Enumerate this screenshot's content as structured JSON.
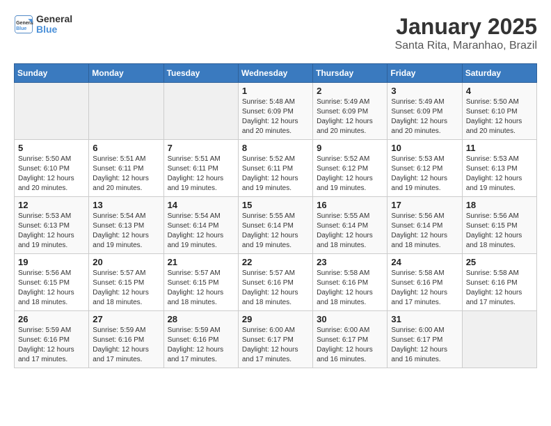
{
  "logo": {
    "line1": "General",
    "line2": "Blue"
  },
  "title": "January 2025",
  "subtitle": "Santa Rita, Maranhao, Brazil",
  "days_of_week": [
    "Sunday",
    "Monday",
    "Tuesday",
    "Wednesday",
    "Thursday",
    "Friday",
    "Saturday"
  ],
  "weeks": [
    [
      {
        "day": "",
        "info": ""
      },
      {
        "day": "",
        "info": ""
      },
      {
        "day": "",
        "info": ""
      },
      {
        "day": "1",
        "info": "Sunrise: 5:48 AM\nSunset: 6:09 PM\nDaylight: 12 hours and 20 minutes."
      },
      {
        "day": "2",
        "info": "Sunrise: 5:49 AM\nSunset: 6:09 PM\nDaylight: 12 hours and 20 minutes."
      },
      {
        "day": "3",
        "info": "Sunrise: 5:49 AM\nSunset: 6:09 PM\nDaylight: 12 hours and 20 minutes."
      },
      {
        "day": "4",
        "info": "Sunrise: 5:50 AM\nSunset: 6:10 PM\nDaylight: 12 hours and 20 minutes."
      }
    ],
    [
      {
        "day": "5",
        "info": "Sunrise: 5:50 AM\nSunset: 6:10 PM\nDaylight: 12 hours and 20 minutes."
      },
      {
        "day": "6",
        "info": "Sunrise: 5:51 AM\nSunset: 6:11 PM\nDaylight: 12 hours and 20 minutes."
      },
      {
        "day": "7",
        "info": "Sunrise: 5:51 AM\nSunset: 6:11 PM\nDaylight: 12 hours and 19 minutes."
      },
      {
        "day": "8",
        "info": "Sunrise: 5:52 AM\nSunset: 6:11 PM\nDaylight: 12 hours and 19 minutes."
      },
      {
        "day": "9",
        "info": "Sunrise: 5:52 AM\nSunset: 6:12 PM\nDaylight: 12 hours and 19 minutes."
      },
      {
        "day": "10",
        "info": "Sunrise: 5:53 AM\nSunset: 6:12 PM\nDaylight: 12 hours and 19 minutes."
      },
      {
        "day": "11",
        "info": "Sunrise: 5:53 AM\nSunset: 6:13 PM\nDaylight: 12 hours and 19 minutes."
      }
    ],
    [
      {
        "day": "12",
        "info": "Sunrise: 5:53 AM\nSunset: 6:13 PM\nDaylight: 12 hours and 19 minutes."
      },
      {
        "day": "13",
        "info": "Sunrise: 5:54 AM\nSunset: 6:13 PM\nDaylight: 12 hours and 19 minutes."
      },
      {
        "day": "14",
        "info": "Sunrise: 5:54 AM\nSunset: 6:14 PM\nDaylight: 12 hours and 19 minutes."
      },
      {
        "day": "15",
        "info": "Sunrise: 5:55 AM\nSunset: 6:14 PM\nDaylight: 12 hours and 19 minutes."
      },
      {
        "day": "16",
        "info": "Sunrise: 5:55 AM\nSunset: 6:14 PM\nDaylight: 12 hours and 18 minutes."
      },
      {
        "day": "17",
        "info": "Sunrise: 5:56 AM\nSunset: 6:14 PM\nDaylight: 12 hours and 18 minutes."
      },
      {
        "day": "18",
        "info": "Sunrise: 5:56 AM\nSunset: 6:15 PM\nDaylight: 12 hours and 18 minutes."
      }
    ],
    [
      {
        "day": "19",
        "info": "Sunrise: 5:56 AM\nSunset: 6:15 PM\nDaylight: 12 hours and 18 minutes."
      },
      {
        "day": "20",
        "info": "Sunrise: 5:57 AM\nSunset: 6:15 PM\nDaylight: 12 hours and 18 minutes."
      },
      {
        "day": "21",
        "info": "Sunrise: 5:57 AM\nSunset: 6:15 PM\nDaylight: 12 hours and 18 minutes."
      },
      {
        "day": "22",
        "info": "Sunrise: 5:57 AM\nSunset: 6:16 PM\nDaylight: 12 hours and 18 minutes."
      },
      {
        "day": "23",
        "info": "Sunrise: 5:58 AM\nSunset: 6:16 PM\nDaylight: 12 hours and 18 minutes."
      },
      {
        "day": "24",
        "info": "Sunrise: 5:58 AM\nSunset: 6:16 PM\nDaylight: 12 hours and 17 minutes."
      },
      {
        "day": "25",
        "info": "Sunrise: 5:58 AM\nSunset: 6:16 PM\nDaylight: 12 hours and 17 minutes."
      }
    ],
    [
      {
        "day": "26",
        "info": "Sunrise: 5:59 AM\nSunset: 6:16 PM\nDaylight: 12 hours and 17 minutes."
      },
      {
        "day": "27",
        "info": "Sunrise: 5:59 AM\nSunset: 6:16 PM\nDaylight: 12 hours and 17 minutes."
      },
      {
        "day": "28",
        "info": "Sunrise: 5:59 AM\nSunset: 6:16 PM\nDaylight: 12 hours and 17 minutes."
      },
      {
        "day": "29",
        "info": "Sunrise: 6:00 AM\nSunset: 6:17 PM\nDaylight: 12 hours and 17 minutes."
      },
      {
        "day": "30",
        "info": "Sunrise: 6:00 AM\nSunset: 6:17 PM\nDaylight: 12 hours and 16 minutes."
      },
      {
        "day": "31",
        "info": "Sunrise: 6:00 AM\nSunset: 6:17 PM\nDaylight: 12 hours and 16 minutes."
      },
      {
        "day": "",
        "info": ""
      }
    ]
  ]
}
